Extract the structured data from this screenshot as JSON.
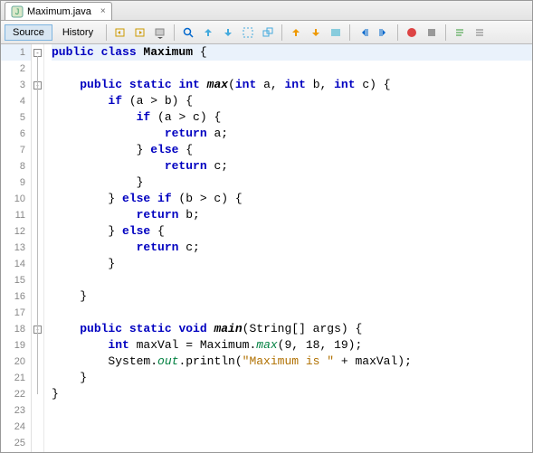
{
  "tab": {
    "filename": "Maximum.java"
  },
  "toolbar": {
    "source_label": "Source",
    "history_label": "History"
  },
  "code": {
    "total_lines": 25,
    "highlighted_line": 1,
    "fold_markers": [
      1,
      3,
      18
    ],
    "lines": [
      [
        {
          "t": "public ",
          "c": "kw"
        },
        {
          "t": "class ",
          "c": "kw"
        },
        {
          "t": "Maximum",
          "c": "cls"
        },
        {
          "t": " {",
          "c": "pln"
        }
      ],
      [],
      [
        {
          "t": "    ",
          "c": "pln"
        },
        {
          "t": "public ",
          "c": "kw"
        },
        {
          "t": "static ",
          "c": "kw"
        },
        {
          "t": "int ",
          "c": "type"
        },
        {
          "t": "max",
          "c": "mth"
        },
        {
          "t": "(",
          "c": "pln"
        },
        {
          "t": "int",
          "c": "type"
        },
        {
          "t": " a, ",
          "c": "pln"
        },
        {
          "t": "int",
          "c": "type"
        },
        {
          "t": " b, ",
          "c": "pln"
        },
        {
          "t": "int",
          "c": "type"
        },
        {
          "t": " c) {",
          "c": "pln"
        }
      ],
      [
        {
          "t": "        ",
          "c": "pln"
        },
        {
          "t": "if",
          "c": "kw"
        },
        {
          "t": " (a > b) {",
          "c": "pln"
        }
      ],
      [
        {
          "t": "            ",
          "c": "pln"
        },
        {
          "t": "if",
          "c": "kw"
        },
        {
          "t": " (a > c) {",
          "c": "pln"
        }
      ],
      [
        {
          "t": "                ",
          "c": "pln"
        },
        {
          "t": "return",
          "c": "kw"
        },
        {
          "t": " a;",
          "c": "pln"
        }
      ],
      [
        {
          "t": "            } ",
          "c": "pln"
        },
        {
          "t": "else",
          "c": "kw"
        },
        {
          "t": " {",
          "c": "pln"
        }
      ],
      [
        {
          "t": "                ",
          "c": "pln"
        },
        {
          "t": "return",
          "c": "kw"
        },
        {
          "t": " c;",
          "c": "pln"
        }
      ],
      [
        {
          "t": "            }",
          "c": "pln"
        }
      ],
      [
        {
          "t": "        } ",
          "c": "pln"
        },
        {
          "t": "else if",
          "c": "kw"
        },
        {
          "t": " (b > c) {",
          "c": "pln"
        }
      ],
      [
        {
          "t": "            ",
          "c": "pln"
        },
        {
          "t": "return",
          "c": "kw"
        },
        {
          "t": " b;",
          "c": "pln"
        }
      ],
      [
        {
          "t": "        } ",
          "c": "pln"
        },
        {
          "t": "else",
          "c": "kw"
        },
        {
          "t": " {",
          "c": "pln"
        }
      ],
      [
        {
          "t": "            ",
          "c": "pln"
        },
        {
          "t": "return",
          "c": "kw"
        },
        {
          "t": " c;",
          "c": "pln"
        }
      ],
      [
        {
          "t": "        }",
          "c": "pln"
        }
      ],
      [],
      [
        {
          "t": "    }",
          "c": "pln"
        }
      ],
      [],
      [
        {
          "t": "    ",
          "c": "pln"
        },
        {
          "t": "public ",
          "c": "kw"
        },
        {
          "t": "static ",
          "c": "kw"
        },
        {
          "t": "void ",
          "c": "type"
        },
        {
          "t": "main",
          "c": "mth"
        },
        {
          "t": "(String[] args) {",
          "c": "pln"
        }
      ],
      [
        {
          "t": "        ",
          "c": "pln"
        },
        {
          "t": "int",
          "c": "type"
        },
        {
          "t": " maxVal = Maximum.",
          "c": "pln"
        },
        {
          "t": "max",
          "c": "fld"
        },
        {
          "t": "(9, 18, 19);",
          "c": "pln"
        }
      ],
      [
        {
          "t": "        System.",
          "c": "pln"
        },
        {
          "t": "out",
          "c": "fld"
        },
        {
          "t": ".println(",
          "c": "pln"
        },
        {
          "t": "\"Maximum is \"",
          "c": "str"
        },
        {
          "t": " + maxVal);",
          "c": "pln"
        }
      ],
      [
        {
          "t": "    }",
          "c": "pln"
        }
      ],
      [
        {
          "t": "}",
          "c": "pln"
        }
      ],
      [],
      [],
      []
    ]
  },
  "icons": {
    "java": "J",
    "close": "×"
  }
}
